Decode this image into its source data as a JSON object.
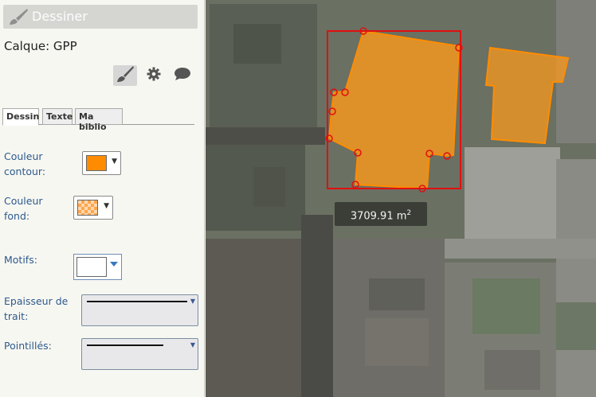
{
  "panel": {
    "title": "Dessiner",
    "title_icon": "brush-icon",
    "layer_text": "Calque: GPP",
    "tool_icons": [
      "brush-icon",
      "gear-icon",
      "speech-bubble-icon"
    ]
  },
  "tabs": [
    {
      "label": "Dessin",
      "active": true
    },
    {
      "label": "Texte",
      "active": false
    },
    {
      "label": "Ma biblio",
      "active": false
    }
  ],
  "fields": {
    "couleur_contour_label_1": "Couleur",
    "couleur_contour_label_2": "contour:",
    "couleur_contour_value": "#ff8c00",
    "couleur_fond_label_1": "Couleur",
    "couleur_fond_label_2": "fond:",
    "couleur_fond_value": "#ffa64d",
    "motifs_label": "Motifs:",
    "epaisseur_label_1": "Epaisseur de",
    "epaisseur_label_2": "trait:",
    "pointilles_label": "Pointillés:"
  },
  "map": {
    "area_value": "3709.91 m",
    "area_unit_sup": "2",
    "selection_color": "#e01010",
    "fill_color": "#ff9a1a"
  }
}
